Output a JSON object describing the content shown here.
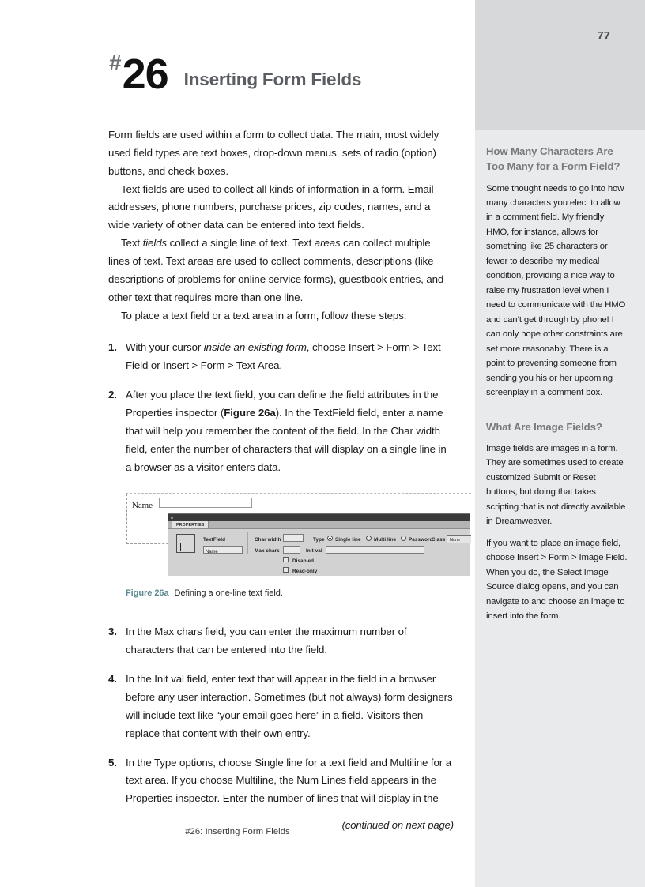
{
  "page": {
    "number": "77",
    "footer": "#26:  Inserting Form Fields"
  },
  "title": {
    "hash": "#",
    "number": "26",
    "text": "Inserting Form Fields"
  },
  "main": {
    "paragraphs": [
      "Form fields are used within a form to collect data. The main, most widely used field types are text boxes, drop-down menus, sets of radio (option) buttons, and check boxes.",
      "Text fields are used to collect all kinds of information in a form. Email addresses, phone numbers, purchase prices, zip codes, names, and a wide variety of other data can be entered into text fields.",
      "To place a text field or a text area in a form, follow these steps:"
    ],
    "paragraph_text_italic": {
      "lead": "Text ",
      "italic1": "fields",
      "mid": " collect a single line of text. Text ",
      "italic2": "areas",
      "tail": " can collect multiple lines of text. Text areas are used to collect comments, descriptions (like descriptions of problems for online service forms), guestbook entries, and other text that requires more than one line."
    },
    "steps": [
      {
        "num": "1.",
        "pre": "With your cursor ",
        "italic": "inside an existing form",
        "post": ", choose Insert > Form > Text Field or Insert > Form > Text Area."
      },
      {
        "num": "2.",
        "pre": "After you place the text field, you can define the field attributes in the Properties inspector (",
        "bold": "Figure 26a",
        "post": "). In the TextField field, enter a name that will help you remember the content of the field. In the Char width field, enter the number of characters that will display on a single line in a browser as a visitor enters data."
      },
      {
        "num": "3.",
        "text": "In the Max chars field, you can enter the maximum number of characters that can be entered into the field."
      },
      {
        "num": "4.",
        "text": "In the Init val field, enter text that will appear in the field in a browser before any user interaction. Sometimes (but not always) form designers will include text like “your email goes here” in a field. Visitors then replace that content with their own entry."
      },
      {
        "num": "5.",
        "text": "In the Type options, choose Single line for a text field and Multiline for a text area. If you choose Multiline, the Num Lines field appears in the Properties inspector. Enter the number of lines that will display in the"
      }
    ],
    "continued": "(continued on next page)"
  },
  "figure": {
    "label": "Figure 26a",
    "caption": "Defining a one-line text field.",
    "screenshot": {
      "form_name_label": "Name",
      "form_name_value": "",
      "panel_tab": "PROPERTIES",
      "field_type_label": "TextField",
      "field_name_value": "Name",
      "char_width_label": "Char width",
      "char_width_value": "",
      "max_chars_label": "Max chars",
      "max_chars_value": "",
      "type_label": "Type",
      "radio_single_line": "Single line",
      "radio_multi_line": "Multi line",
      "radio_password": "Password",
      "selected_type": "Single line",
      "init_val_label": "Init val",
      "init_val_value": "",
      "class_label": "Class",
      "class_value": "None",
      "checkbox_disabled": "Disabled",
      "checkbox_readonly": "Read-only"
    }
  },
  "sidebar": {
    "section1": {
      "heading": "How Many Characters Are Too Many for a Form Field?",
      "paragraphs": [
        "Some thought needs to go into how many characters you elect to allow in a comment field. My friendly HMO, for instance, allows for something like 25 characters or fewer to describe my medical condition, providing a nice way to raise my frustration level when I need to communicate with the HMO and can’t get through by phone! I can only hope other constraints are set more reasonably. There is a point to preventing someone from sending you his or her upcoming screenplay in a comment box."
      ]
    },
    "section2": {
      "heading": "What Are Image Fields?",
      "paragraphs": [
        "Image fields are images in a form. They are sometimes used to create customized Submit or Reset buttons, but doing that takes scripting that is not directly available in Dreamweaver.",
        "If you want to place an image field, choose Insert > Form > Image Field. When you do, the Select Image Source dialog opens, and you can navigate to and choose an image to insert into the form."
      ]
    }
  },
  "colors": {
    "sidebar_band": "#d6d8da",
    "sidebar_bg": "#e9eaec",
    "figure_label": "#5c8a92",
    "title_subtitle": "#5a5d61"
  }
}
